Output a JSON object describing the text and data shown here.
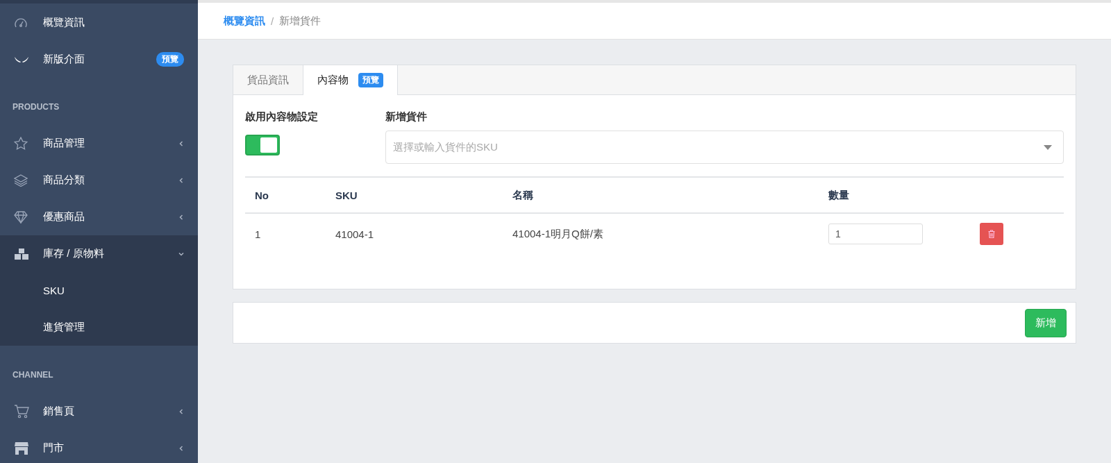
{
  "sidebar": {
    "items": [
      {
        "kind": "link",
        "label": "概覽資訊"
      },
      {
        "kind": "link",
        "label": "新版介面",
        "badge": "預覽"
      },
      {
        "kind": "header",
        "label": "PRODUCTS"
      },
      {
        "kind": "menu",
        "label": "商品管理",
        "expanded": false
      },
      {
        "kind": "menu",
        "label": "商品分類",
        "expanded": false
      },
      {
        "kind": "menu",
        "label": "優惠商品",
        "expanded": false
      },
      {
        "kind": "menu",
        "label": "庫存 / 原物料",
        "expanded": true,
        "children": [
          {
            "label": "SKU"
          },
          {
            "label": "進貨管理"
          }
        ]
      },
      {
        "kind": "header",
        "label": "CHANNEL"
      },
      {
        "kind": "menu",
        "label": "銷售頁",
        "expanded": false
      },
      {
        "kind": "menu",
        "label": "門市",
        "expanded": false
      }
    ]
  },
  "breadcrumb": [
    {
      "label": "概覽資訊",
      "link": true
    },
    {
      "label": "新增貨件",
      "link": false
    }
  ],
  "breadcrumb_separator": "/",
  "tabs": [
    {
      "label": "貨品資訊",
      "selected": false
    },
    {
      "label": "內容物",
      "badge": "預覽",
      "selected": true
    }
  ],
  "toggle": {
    "label": "啟用內容物設定",
    "on": true
  },
  "select": {
    "label": "新增貨件",
    "placeholder": "選擇或輸入貨件的SKU"
  },
  "table": {
    "columns": [
      "No",
      "SKU",
      "名稱",
      "數量"
    ],
    "rows": [
      {
        "no": "1",
        "sku": "41004-1",
        "name": "41004-1明月Q餅/素",
        "quantity": "1"
      }
    ]
  },
  "submit_button": "新增"
}
